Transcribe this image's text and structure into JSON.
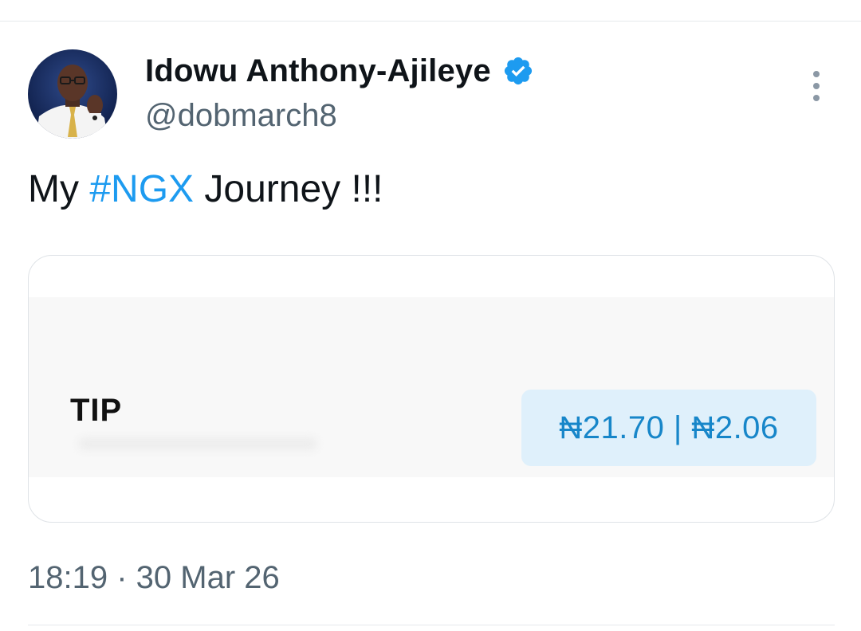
{
  "author": {
    "display_name": "Idowu Anthony-Ajileye",
    "handle": "@dobmarch8",
    "avatar_icon": "profile-photo",
    "verified_icon": "verified-badge-icon",
    "verified_color": "#1d9bf0"
  },
  "actions": {
    "more_icon": "more-vertical-icon"
  },
  "tweet": {
    "text_before": "My ",
    "hashtag": "#NGX",
    "text_after": " Journey !!!",
    "hashtag_color": "#1d9bf0"
  },
  "media": {
    "ticker": "TIP",
    "price_text": "₦21.70 | ₦2.06",
    "chip_color": "#dff0fb",
    "price_color": "#1786c9"
  },
  "meta": {
    "timestamp": "18:19 · 30 Mar 26"
  }
}
